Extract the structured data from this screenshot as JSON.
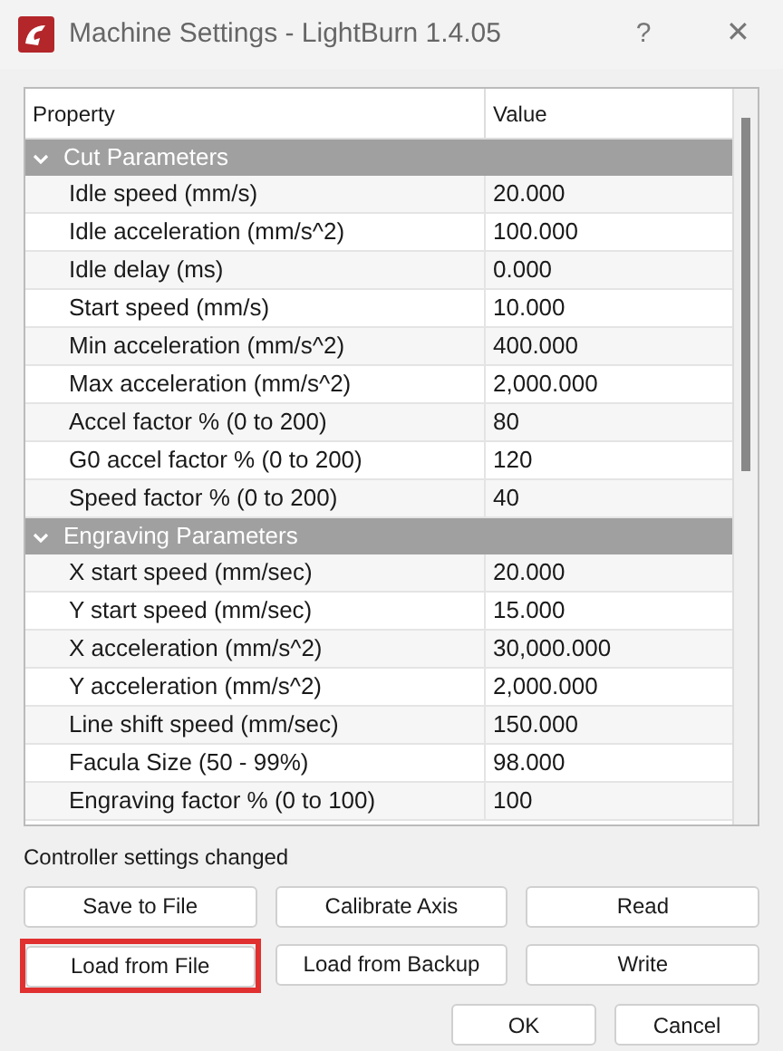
{
  "window": {
    "title": "Machine Settings - LightBurn 1.4.05",
    "help": "?",
    "close": "✕"
  },
  "table": {
    "columns": [
      "Property",
      "Value"
    ],
    "groups": [
      {
        "title": "Cut Parameters",
        "expanded": true,
        "rows": [
          {
            "property": "Idle speed (mm/s)",
            "value": "20.000"
          },
          {
            "property": "Idle acceleration (mm/s^2)",
            "value": "100.000"
          },
          {
            "property": "Idle delay (ms)",
            "value": "0.000"
          },
          {
            "property": "Start speed (mm/s)",
            "value": "10.000"
          },
          {
            "property": "Min acceleration (mm/s^2)",
            "value": "400.000"
          },
          {
            "property": "Max acceleration (mm/s^2)",
            "value": "2,000.000"
          },
          {
            "property": "Accel factor % (0 to 200)",
            "value": "80"
          },
          {
            "property": "G0 accel factor % (0 to 200)",
            "value": "120"
          },
          {
            "property": "Speed factor % (0 to 200)",
            "value": "40"
          }
        ]
      },
      {
        "title": "Engraving Parameters",
        "expanded": true,
        "rows": [
          {
            "property": "X start speed (mm/sec)",
            "value": "20.000"
          },
          {
            "property": "Y start speed (mm/sec)",
            "value": "15.000"
          },
          {
            "property": "X acceleration (mm/s^2)",
            "value": "30,000.000"
          },
          {
            "property": "Y acceleration (mm/s^2)",
            "value": "2,000.000"
          },
          {
            "property": "Line shift speed (mm/sec)",
            "value": "150.000"
          },
          {
            "property": "Facula Size (50 - 99%)",
            "value": "98.000"
          },
          {
            "property": "Engraving factor % (0 to 100)",
            "value": "100"
          }
        ]
      }
    ]
  },
  "status": "Controller settings changed",
  "buttons": [
    {
      "label": "Save to File",
      "highlighted": false
    },
    {
      "label": "Calibrate Axis",
      "highlighted": false
    },
    {
      "label": "Read",
      "highlighted": false
    },
    {
      "label": "Load from File",
      "highlighted": true
    },
    {
      "label": "Load from Backup",
      "highlighted": false
    },
    {
      "label": "Write",
      "highlighted": false
    }
  ],
  "dialog_buttons": [
    "OK",
    "Cancel"
  ]
}
